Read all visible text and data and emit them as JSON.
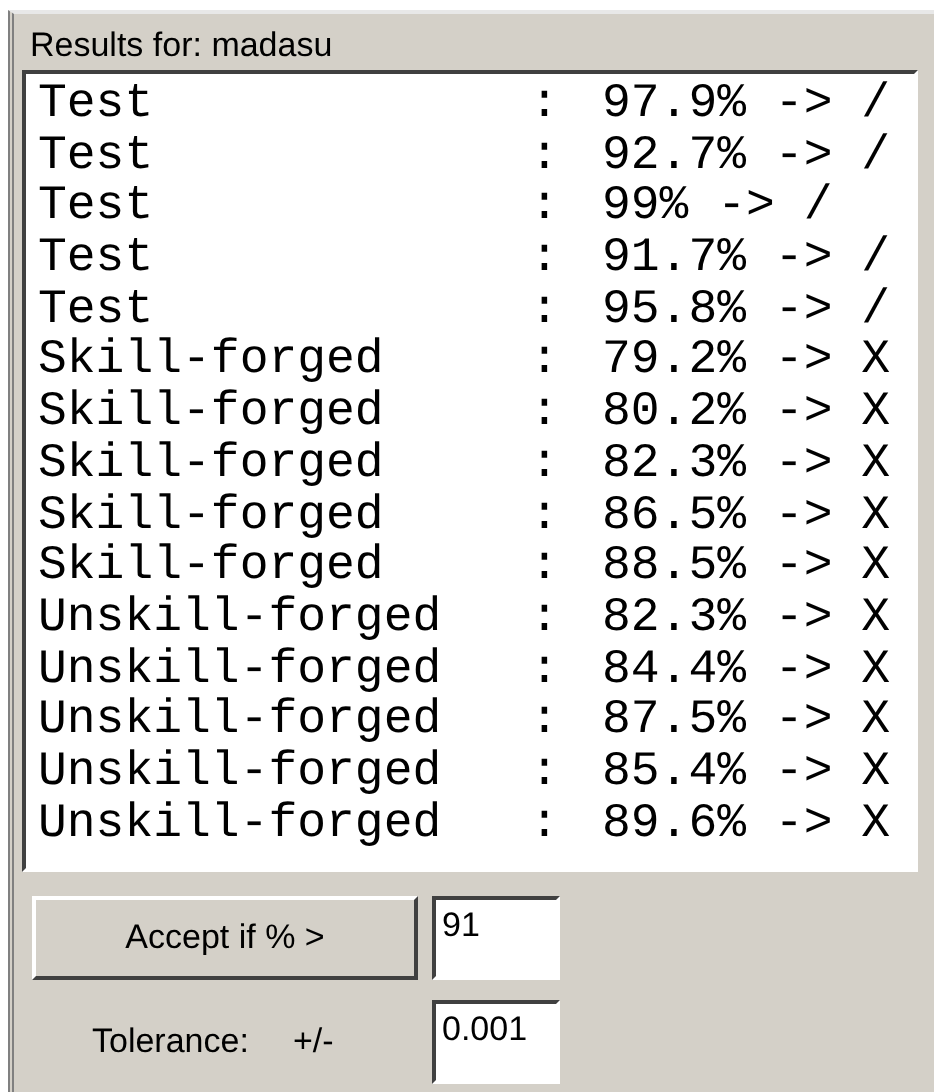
{
  "header": "Results for: madasu",
  "results": [
    {
      "label": "Test",
      "separator": ":",
      "value": "97.9% -> /"
    },
    {
      "label": "Test",
      "separator": ":",
      "value": "92.7% -> /"
    },
    {
      "label": "Test",
      "separator": ":",
      "value": "99% -> /"
    },
    {
      "label": "Test",
      "separator": ":",
      "value": "91.7% -> /"
    },
    {
      "label": "Test",
      "separator": ":",
      "value": "95.8% -> /"
    },
    {
      "label": "Skill-forged",
      "separator": ":",
      "value": "79.2% -> X"
    },
    {
      "label": "Skill-forged",
      "separator": ":",
      "value": "80.2% -> X"
    },
    {
      "label": "Skill-forged",
      "separator": ":",
      "value": "82.3% -> X"
    },
    {
      "label": "Skill-forged",
      "separator": ":",
      "value": "86.5% -> X"
    },
    {
      "label": "Skill-forged",
      "separator": ":",
      "value": "88.5% -> X"
    },
    {
      "label": "Unskill-forged",
      "separator": ":",
      "value": "82.3% -> X"
    },
    {
      "label": "Unskill-forged",
      "separator": ":",
      "value": "84.4% -> X"
    },
    {
      "label": "Unskill-forged",
      "separator": ":",
      "value": "87.5% -> X"
    },
    {
      "label": "Unskill-forged",
      "separator": ":",
      "value": "85.4% -> X"
    },
    {
      "label": "Unskill-forged",
      "separator": ":",
      "value": "89.6% -> X"
    }
  ],
  "accept_button": "Accept if % >",
  "accept_value": "91",
  "tolerance_label": "Tolerance:",
  "tolerance_sign": "+/-",
  "tolerance_value": "0.001"
}
